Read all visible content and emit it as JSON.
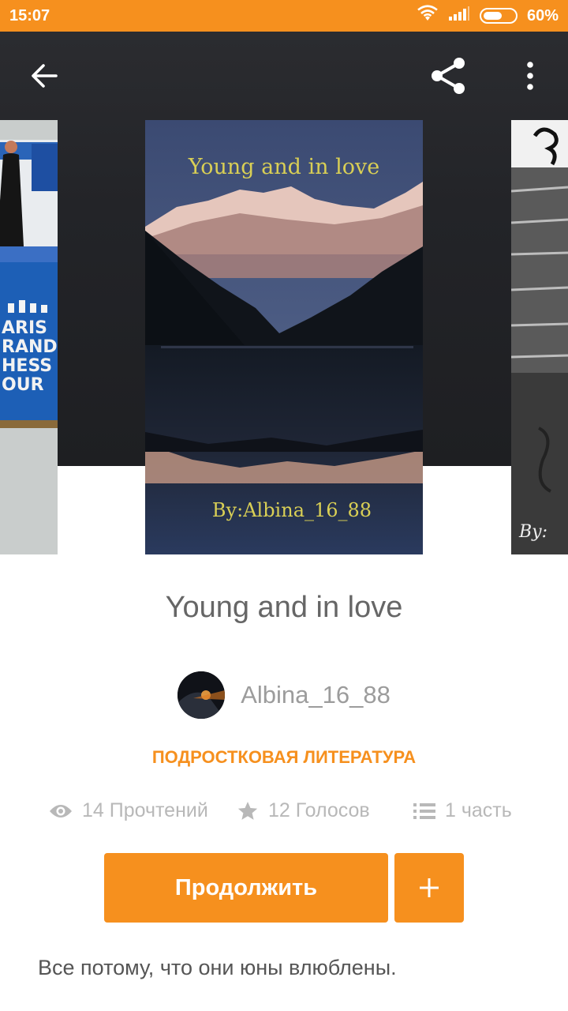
{
  "status_bar": {
    "time": "15:07",
    "battery_text": "60%",
    "battery_level": 0.6,
    "icons": [
      "wifi-icon",
      "signal-icon",
      "battery-icon"
    ]
  },
  "toolbar": {
    "icons": [
      "back-arrow-icon",
      "share-icon",
      "more-vertical-icon"
    ]
  },
  "covers": {
    "main": {
      "title": "Young and in love",
      "byline": "By:Albina_16_88"
    },
    "left": {
      "lines": [
        "ARIS",
        "RAND",
        "HESS",
        "OUR"
      ]
    },
    "right": {
      "label": "By: "
    }
  },
  "story": {
    "title": "Young and in love",
    "author": "Albina_16_88",
    "category": "ПОДРОСТКОВАЯ ЛИТЕРАТУРА",
    "stats": {
      "reads": "14 Прочтений",
      "votes": "12 Голосов",
      "parts": "1 часть"
    },
    "continue_label": "Продолжить",
    "add_label": "+",
    "description": "Все потому, что они юны влюблены."
  },
  "colors": {
    "accent": "#f6901e",
    "header_bg": "#232428",
    "muted_text": "#b8b8b8"
  }
}
